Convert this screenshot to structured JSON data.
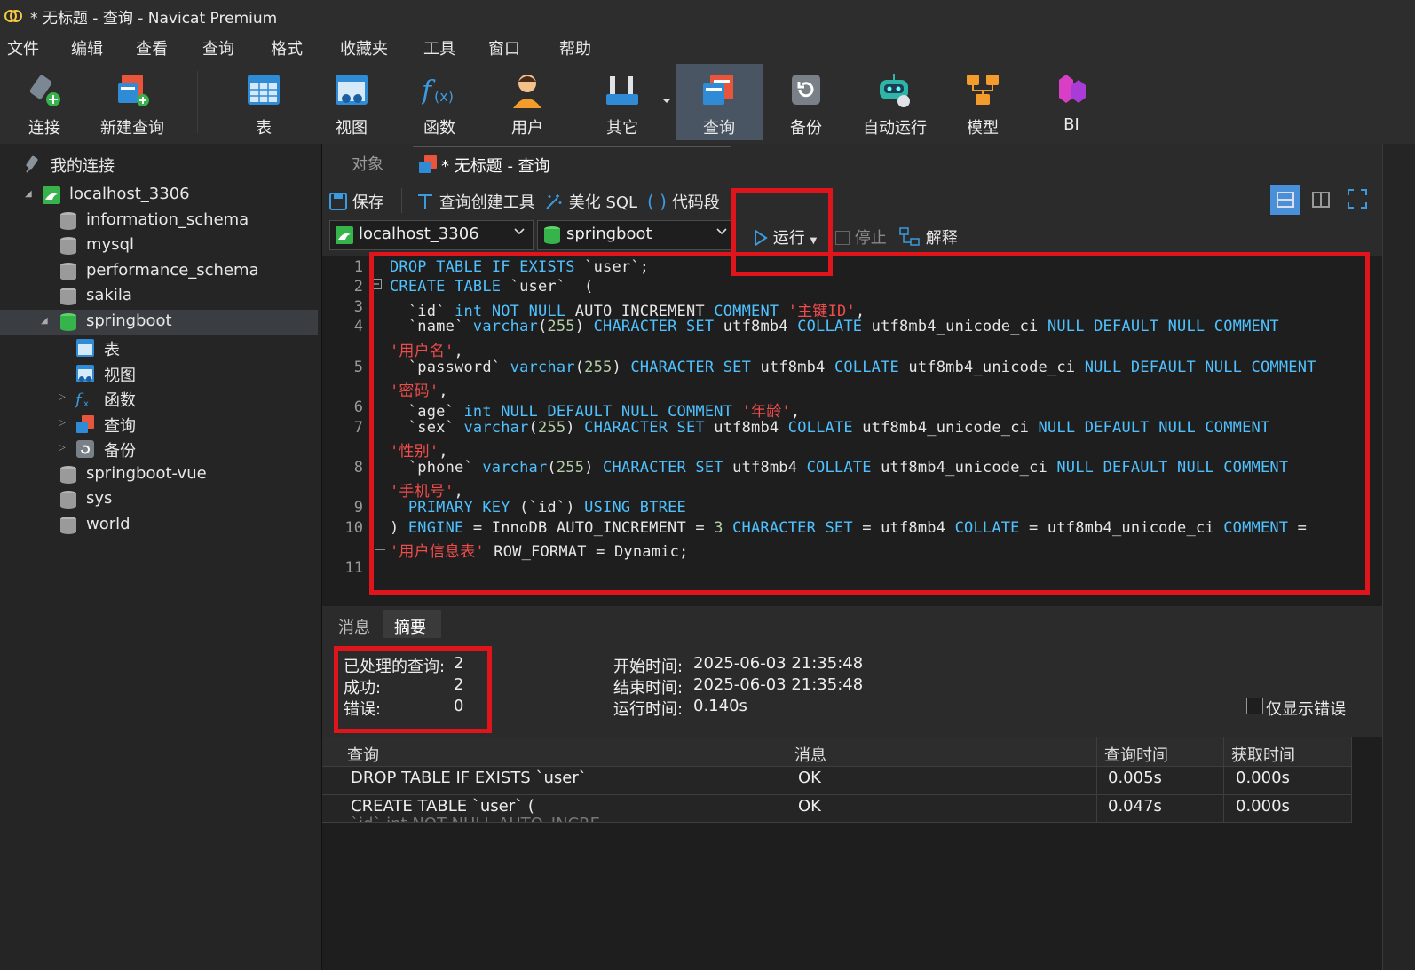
{
  "window": {
    "title": "* 无标题 - 查询 - Navicat Premium"
  },
  "menu": [
    "文件",
    "编辑",
    "查看",
    "查询",
    "格式",
    "收藏夹",
    "工具",
    "窗口",
    "帮助"
  ],
  "toolbar": {
    "connect": "连接",
    "new_query": "新建查询",
    "table": "表",
    "view": "视图",
    "function": "函数",
    "user": "用户",
    "other": "其它",
    "query": "查询",
    "backup": "备份",
    "automation": "自动运行",
    "model": "模型",
    "bi": "BI"
  },
  "sidebar": {
    "header": "我的连接",
    "connection": "localhost_3306",
    "databases": [
      "information_schema",
      "mysql",
      "performance_schema",
      "sakila",
      "springboot",
      "springboot-vue",
      "sys",
      "world"
    ],
    "children": [
      "表",
      "视图",
      "函数",
      "查询",
      "备份"
    ]
  },
  "tabs": {
    "objects": "对象",
    "query_tab": "* 无标题 - 查询"
  },
  "editor_toolbar": {
    "save": "保存",
    "query_builder": "查询创建工具",
    "beautify": "美化 SQL",
    "snippet": "代码段",
    "connection_select": "localhost_3306",
    "database_select": "springboot",
    "run": "运行",
    "stop": "停止",
    "explain": "解释"
  },
  "code_lines": [
    "DROP TABLE IF EXISTS `user`;",
    "CREATE TABLE `user`  (",
    "  `id` int NOT NULL AUTO_INCREMENT COMMENT '主键ID',",
    "  `name` varchar(255) CHARACTER SET utf8mb4 COLLATE utf8mb4_unicode_ci NULL DEFAULT NULL COMMENT",
    "'用户名',",
    "  `password` varchar(255) CHARACTER SET utf8mb4 COLLATE utf8mb4_unicode_ci NULL DEFAULT NULL COMMENT",
    "'密码',",
    "  `age` int NULL DEFAULT NULL COMMENT '年龄',",
    "  `sex` varchar(255) CHARACTER SET utf8mb4 COLLATE utf8mb4_unicode_ci NULL DEFAULT NULL COMMENT",
    "'性别',",
    "  `phone` varchar(255) CHARACTER SET utf8mb4 COLLATE utf8mb4_unicode_ci NULL DEFAULT NULL COMMENT",
    "'手机号',",
    "  PRIMARY KEY (`id`) USING BTREE",
    ") ENGINE = InnoDB AUTO_INCREMENT = 3 CHARACTER SET = utf8mb4 COLLATE = utf8mb4_unicode_ci COMMENT =",
    "'用户信息表' ROW_FORMAT = Dynamic;"
  ],
  "line_numbers": [
    "1",
    "2",
    "3",
    "4",
    "5",
    "6",
    "7",
    "8",
    "9",
    "10",
    "11"
  ],
  "result_tabs": {
    "messages": "消息",
    "summary": "摘要"
  },
  "summary": {
    "processed_label": "已处理的查询:",
    "processed": "2",
    "success_label": "成功:",
    "success": "2",
    "error_label": "错误:",
    "error": "0",
    "start_label": "开始时间:",
    "start": "2025-06-03 21:35:48",
    "end_label": "结束时间:",
    "end": "2025-06-03 21:35:48",
    "elapsed_label": "运行时间:",
    "elapsed": "0.140s",
    "errors_only": "仅显示错误"
  },
  "grid": {
    "headers": [
      "查询",
      "消息",
      "查询时间",
      "获取时间"
    ],
    "rows": [
      [
        "DROP TABLE IF EXISTS `user`",
        "OK",
        "0.005s",
        "0.000s"
      ],
      [
        "CREATE TABLE `user` (",
        "OK",
        "0.047s",
        "0.000s"
      ]
    ],
    "row2_overflow": "`id` int NOT NULL AUTO_INCRE"
  },
  "colors": {
    "accent": "#4fc1ff",
    "string": "#f14c4c",
    "annotation": "#e0141b",
    "active_tool": "#4a5563"
  }
}
